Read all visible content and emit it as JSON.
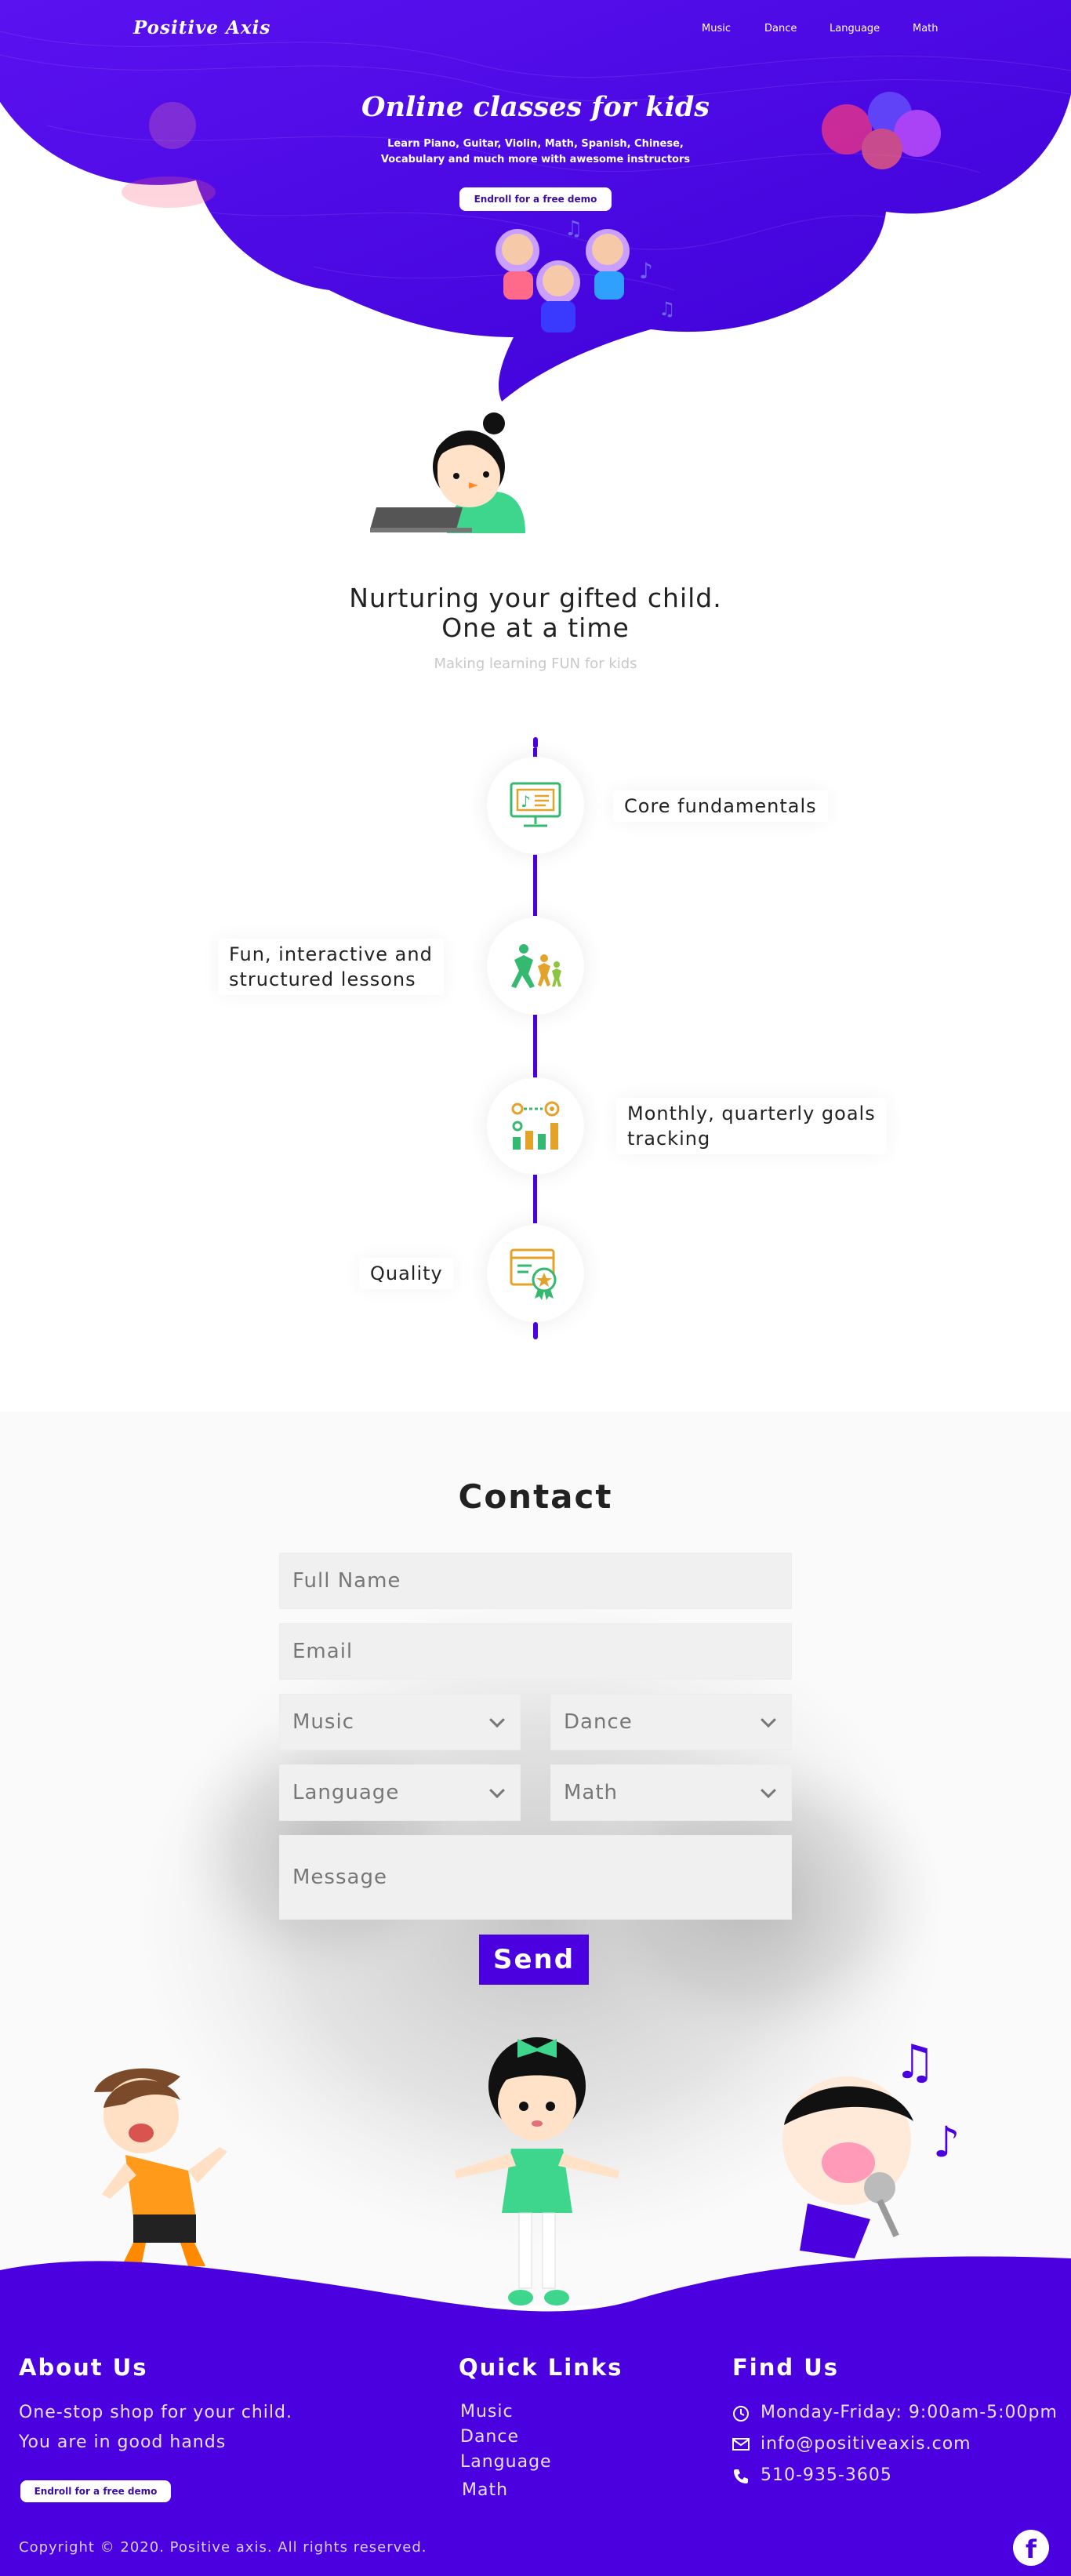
{
  "brand": {
    "logo_text": "Positive Axis"
  },
  "nav": {
    "items": [
      {
        "label": "Music"
      },
      {
        "label": "Dance"
      },
      {
        "label": "Language"
      },
      {
        "label": "Math"
      }
    ]
  },
  "hero": {
    "title": "Online classes for kids",
    "subtitle_line1": "Learn Piano, Guitar, Violin, Math, Spanish, Chinese,",
    "subtitle_line2": "Vocabulary and much more with awesome instructors",
    "cta_label": "Endroll for a free demo"
  },
  "nurture": {
    "title_line1": "Nurturing your gifted child.",
    "title_line2": "One at a time",
    "subtitle": "Making learning FUN for kids"
  },
  "features": [
    {
      "line1": "Core fundamentals",
      "line2": "",
      "icon": "music-lesson-monitor-icon"
    },
    {
      "line1": "Fun, interactive and",
      "line2": "structured lessons",
      "icon": "dancing-kids-icon"
    },
    {
      "line1": "Monthly, quarterly goals",
      "line2": "tracking",
      "icon": "goals-chart-icon"
    },
    {
      "line1": "Quality",
      "line2": "",
      "icon": "quality-badge-icon"
    }
  ],
  "contact": {
    "title": "Contact",
    "full_name_placeholder": "Full Name",
    "email_placeholder": "Email",
    "select_music": "Music",
    "select_dance": "Dance",
    "select_language": "Language",
    "select_math": "Math",
    "message_placeholder": "Message",
    "send_label": "Send"
  },
  "footer": {
    "about_title": "About Us",
    "about_line1": "One-stop shop for your child.",
    "about_line2": "You are in good hands",
    "about_cta": "Endroll for a free demo",
    "links_title": "Quick Links",
    "links": [
      "Music",
      "Dance",
      "Language",
      "Math"
    ],
    "find_title": "Find Us",
    "hours": "Monday-Friday: 9:00am-5:00pm",
    "email": "info@positiveaxis.com",
    "phone": "510-935-3605",
    "copyright": "Copyright © 2020. Positive axis. All rights reserved.",
    "facebook_glyph": "f"
  },
  "colors": {
    "primary": "#4b00e0",
    "hero_purple": "#4a06e4",
    "field_bg": "#f0f0f0",
    "text_dark": "#222222",
    "muted": "#c8c8c8"
  }
}
